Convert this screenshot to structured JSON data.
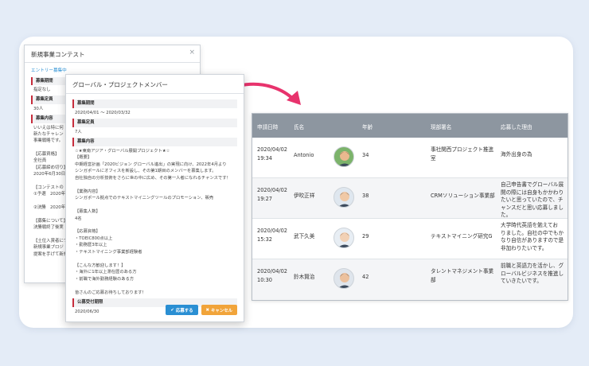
{
  "back_modal": {
    "title": "新規事業コンテスト",
    "close": "×",
    "status": "エントリー募集中",
    "sections": [
      {
        "label": "募集期間",
        "lines": [
          "指定なし"
        ]
      },
      {
        "label": "募集定員",
        "lines": [
          "30人"
        ]
      },
      {
        "label": "募集内容",
        "lines": [
          "いいえは特に何",
          "新たなチャレン",
          "事業戦略です。",
          "",
          "【応募資格】",
          "全社員",
          "【応募締め切り】",
          "2020年6月30日ま",
          "",
          "【コンテストの",
          "①予選　2020年",
          "",
          "②決勝　2020年",
          "",
          "【募集について】",
          "決勝戦終了後実",
          "",
          "【土位入賞者につ",
          "新規事業プロジ",
          "提案を手げて新規事"
        ]
      }
    ]
  },
  "front_modal": {
    "title": "グローバル・プロジェクトメンバー",
    "sections": [
      {
        "label": "募集期間",
        "lines": [
          "2020/04/01 ～ 2020/03/32"
        ]
      },
      {
        "label": "募集定員",
        "lines": [
          "7人"
        ]
      },
      {
        "label": "募集内容",
        "lines": [
          "☆★東南アジア・グローバル展開プロジェクト★☆",
          "【概要】",
          "中期経営計画「2020ビジョン グローバル進出」の実現に向け、2022年4月より",
          "シンガポールにオフィスを新設し、その第1期目のメンバーを募集します。",
          "自社独自の分析技術をさらに世の中に広め、その第一人者になれるチャンスです！",
          "",
          "【業務内容】",
          "シンガポール拠点でのテキストマイニングツールのプロモーション、販売",
          "",
          "【募集人数】",
          "4名",
          "",
          "【応募資格】",
          "・TOEIC800点以上",
          "・勤務歴3年以上",
          "・テキストマイニング事業部経験者",
          "",
          "【こんな方歓迎します！】",
          "・海外に1年以上滞在歴のある方",
          "・前職で海外勤務経験のある方",
          "",
          "皆さんのご応募お待ちしております！"
        ]
      },
      {
        "label": "公募受付期限",
        "lines": [
          "2020/06/30"
        ]
      }
    ],
    "apply_button": "応募する",
    "cancel_button": "キャンセル"
  },
  "table": {
    "headers": [
      "申請日時",
      "氏名",
      "年齢",
      "現部署名",
      "応募した理由"
    ],
    "rows": [
      {
        "date": "2020/04/02",
        "time": "19:34",
        "name": "Antonio",
        "age": "34",
        "dept": [
          "事社関西プロジェクト推進",
          "室"
        ],
        "reason": [
          "海外出身の為"
        ]
      },
      {
        "date": "2020/04/02",
        "time": "19:27",
        "name": "伊吹正祥",
        "age": "38",
        "dept": [
          "CRMソリューション事業部"
        ],
        "reason": [
          "自己申告書でグローバル展",
          "開の際には自身もかかわり",
          "たいと思っていたので、チ",
          "ャンスだと思い応募しまし",
          "た。"
        ]
      },
      {
        "date": "2020/04/02",
        "time": "15:32",
        "name": "武下久美",
        "age": "29",
        "dept": [
          "テキストマイニング研究G"
        ],
        "reason": [
          "大学時代英語を勉えてお",
          "りました。自社の中でもか",
          "なり自信がありますので是",
          "非加わりたいです。"
        ]
      },
      {
        "date": "2020/04/02",
        "time": "10:30",
        "name": "鈴木賢治",
        "age": "42",
        "dept": [
          "タレントマネジメント事業",
          "部"
        ],
        "reason": [
          "前職と英語力を活かし、グ",
          "ローバルビジネスを推進し",
          "ていきたいです。"
        ]
      }
    ]
  },
  "colors": {
    "accent": "#2a8fd3",
    "arrow": "#e8336d",
    "header": "#8d96a0",
    "label_bar": "#c62d3c",
    "cancel": "#f1a43a"
  },
  "icons": [
    "close-icon",
    "check-icon",
    "x-icon",
    "curved-arrow-icon",
    "avatar-icon"
  ]
}
